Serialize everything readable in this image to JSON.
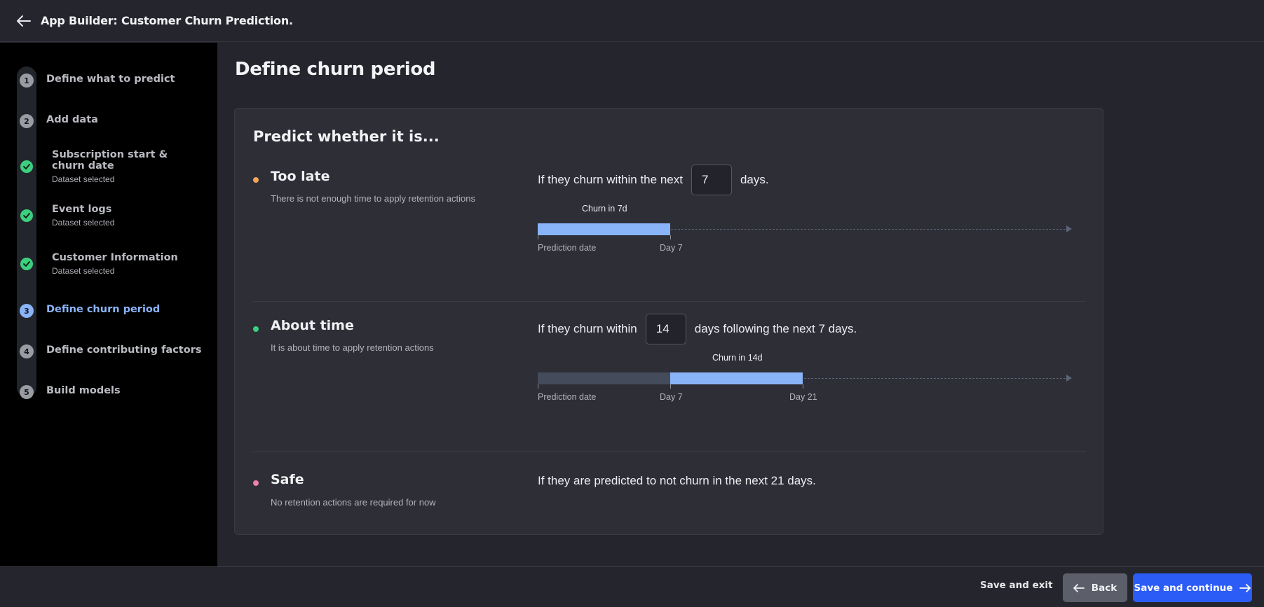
{
  "header": {
    "title": "App Builder: Customer Churn Prediction."
  },
  "sidebar": {
    "steps": [
      {
        "num": "1",
        "label": "Define what to predict"
      },
      {
        "num": "2",
        "label": "Add data"
      },
      {
        "label": "Subscription start & churn date",
        "status": "Dataset selected"
      },
      {
        "label": "Event logs",
        "status": "Dataset selected"
      },
      {
        "label": "Customer Information",
        "status": "Dataset selected"
      },
      {
        "num": "3",
        "label": "Define churn period"
      },
      {
        "num": "4",
        "label": "Define contributing factors"
      },
      {
        "num": "5",
        "label": "Build models"
      }
    ]
  },
  "main": {
    "title": "Define churn period",
    "card_title": "Predict whether it is...",
    "options": [
      {
        "title": "Too late",
        "description": "There is not enough time to apply retention actions",
        "color": "#f2a65a",
        "sentence_before": "If they churn within the next",
        "value": "7",
        "sentence_after": "days.",
        "timeline": {
          "caption": "Churn in 7d",
          "start_label": "Prediction date",
          "end_label": "Day 7"
        }
      },
      {
        "title": "About time",
        "description": "It is about time to apply retention actions",
        "color": "#3ccf7f",
        "sentence_before": "If they churn within",
        "value": "14",
        "sentence_after": "days following the next 7 days.",
        "timeline": {
          "caption": "Churn in 14d",
          "start_label": "Prediction date",
          "mid_label": "Day 7",
          "end_label": "Day 21"
        }
      },
      {
        "title": "Safe",
        "description": "No retention actions are required for now",
        "color": "#ef7fae",
        "sentence": "If they are predicted to not churn in the next 21 days."
      }
    ]
  },
  "footer": {
    "save_exit": "Save and exit",
    "back": "Back",
    "continue": "Save and continue"
  },
  "colors": {
    "accent": "#2c5cf6",
    "active_step": "#8ab4f8",
    "complete": "#3ccf7f",
    "bar_highlight": "#8ab4f8",
    "bar_muted": "#444b5a"
  }
}
